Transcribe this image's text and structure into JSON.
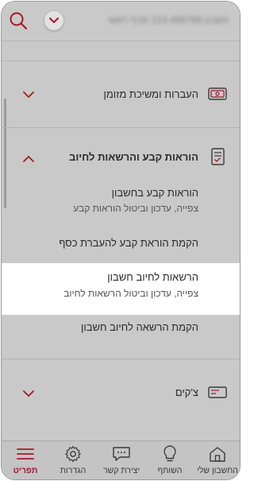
{
  "header": {
    "account_label": "חשבון 123-456789 סניף ראשי"
  },
  "menu": {
    "transfers": {
      "label": "העברות ומשיכת מזומן"
    },
    "standing_orders": {
      "label": "הוראות קבע והרשאות לחיוב",
      "expanded": true,
      "items": [
        {
          "title": "הוראות קבע בחשבון",
          "desc": "צפייה, עדכון וביטול הוראות קבע"
        },
        {
          "title": "הקמת הוראת קבע להעברת כסף",
          "desc": ""
        },
        {
          "title": "הרשאות לחיוב חשבון",
          "desc": "צפייה, עדכון וביטול הרשאות לחיוב",
          "highlighted": true
        },
        {
          "title": "הקמת הרשאה לחיוב חשבון",
          "desc": ""
        }
      ]
    },
    "cheques": {
      "label": "צ'קים"
    }
  },
  "bottom_nav": {
    "items": [
      {
        "label": "תפריט",
        "icon": "menu-icon",
        "active": true
      },
      {
        "label": "הגדרות",
        "icon": "gear-icon"
      },
      {
        "label": "יצירת קשר",
        "icon": "chat-icon"
      },
      {
        "label": "השותף",
        "icon": "lightbulb-icon"
      },
      {
        "label": "החשבון שלי",
        "icon": "home-icon"
      }
    ]
  },
  "colors": {
    "brand": "#a3192a",
    "dim_overlay": "#c9c9c9",
    "text": "#2b2b2b"
  }
}
